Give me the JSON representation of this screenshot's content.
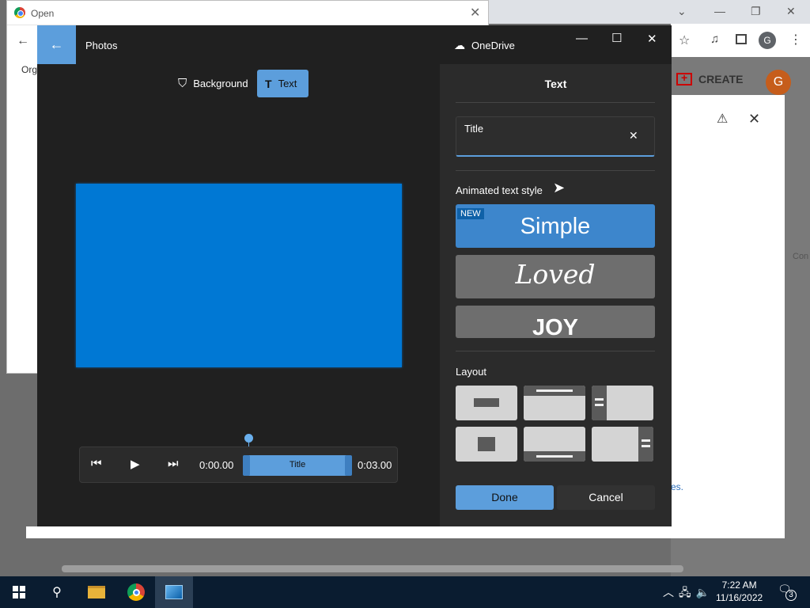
{
  "open_dialog": {
    "title": "Open",
    "toolbar_text": "Org"
  },
  "chrome": {
    "create_label": "CREATE",
    "avatar_letter": "G",
    "profile_letter": "G",
    "side_text": "Con",
    "link_text": "es."
  },
  "photos": {
    "title": "Photos",
    "onedrive_label": "OneDrive",
    "tabs": [
      {
        "label": "Background"
      },
      {
        "label": "Text"
      }
    ],
    "timeline": {
      "start": "0:00.00",
      "end": "0:03.00",
      "clip_label": "Title",
      "playhead_fraction": 0.0
    }
  },
  "text_panel": {
    "heading": "Text",
    "input": {
      "value": "Title"
    },
    "animated_label": "Animated text style",
    "styles": [
      {
        "name": "Simple",
        "badge": "NEW",
        "selected": true
      },
      {
        "name": "Loved",
        "selected": false
      },
      {
        "name": "JOY",
        "selected": false
      }
    ],
    "layout_label": "Layout",
    "layouts": [
      "center-bar",
      "top-bar",
      "left-bar",
      "center-box",
      "bottom-bar",
      "right-bar"
    ],
    "done_label": "Done",
    "cancel_label": "Cancel"
  },
  "taskbar": {
    "time": "7:22 AM",
    "date": "11/16/2022",
    "notification_count": "3",
    "apps": [
      "start-icon",
      "search-icon",
      "file-explorer-icon",
      "chrome-icon",
      "photos-icon"
    ]
  },
  "colors": {
    "accent": "#5c9edc",
    "preview_blue": "#0078d4",
    "panel_bg": "#2b2b2b"
  }
}
